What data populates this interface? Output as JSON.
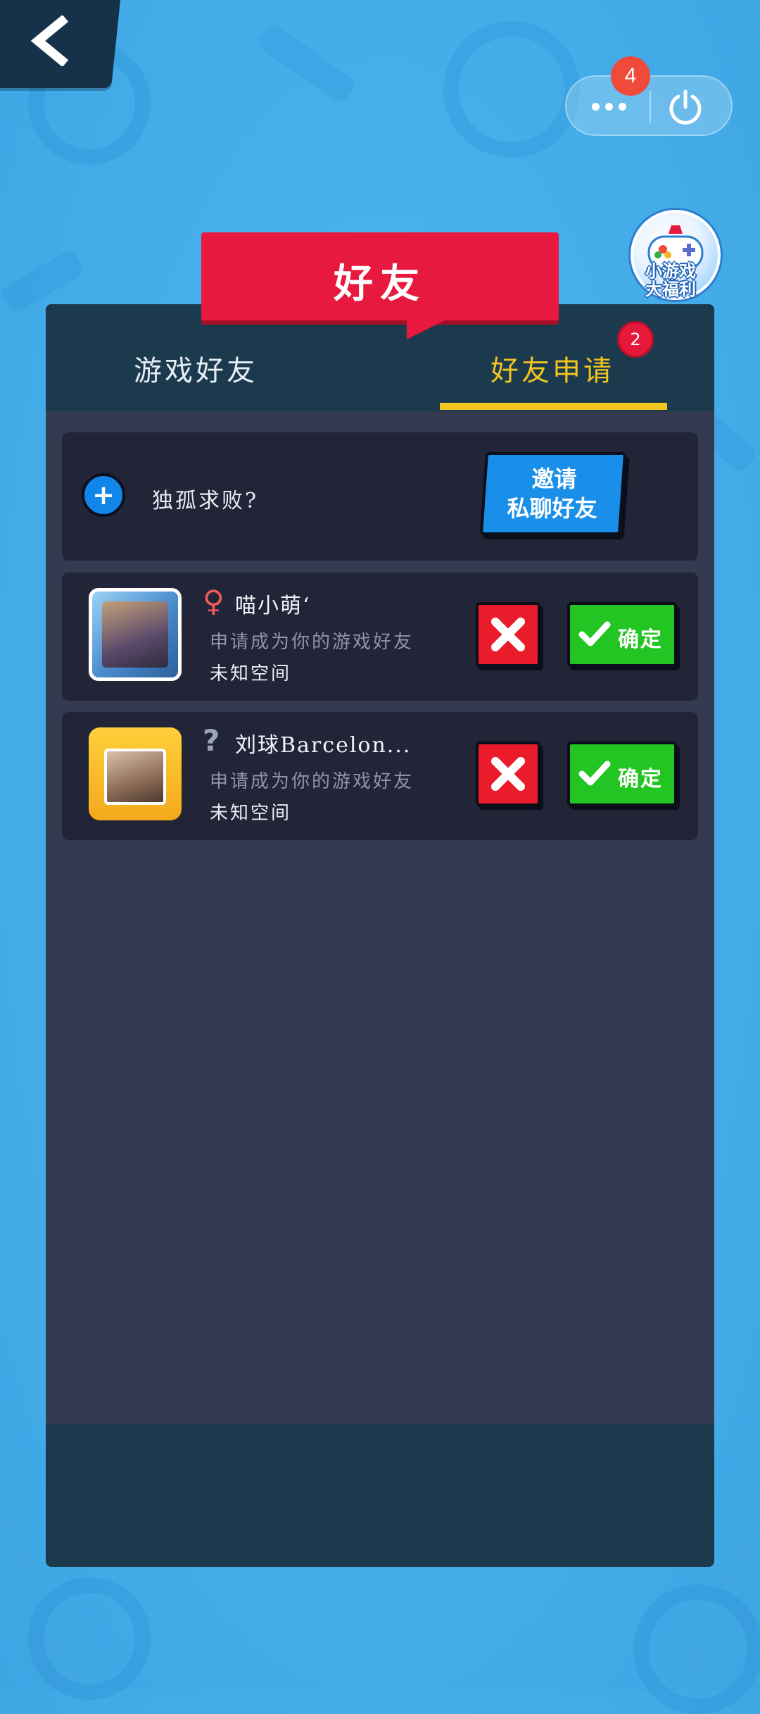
{
  "nav": {
    "back_icon": "chevron-left-icon"
  },
  "capsule": {
    "more_icon": "more-dots-icon",
    "power_icon": "power-icon",
    "badge_count": "4"
  },
  "promo": {
    "label_line1": "小游戏",
    "label_line2": "大福利",
    "icon": "gamepad-gift-icon"
  },
  "title": "好友",
  "tabs": [
    {
      "label": "游戏好友",
      "active": false
    },
    {
      "label": "好友申请",
      "active": true,
      "badge": "2"
    }
  ],
  "invite": {
    "icon": "plus-icon",
    "text": "独孤求败?",
    "button_line1": "邀请",
    "button_line2": "私聊好友"
  },
  "requests": [
    {
      "gender_icon": "♀",
      "name": "喵小萌‘",
      "message": "申请成为你的游戏好友",
      "location": "未知空间",
      "reject_icon": "close-x-icon",
      "accept_icon": "checkmark-icon",
      "accept_label": "确定"
    },
    {
      "gender_icon": "?",
      "name": "刘球Barcelon...",
      "message": "申请成为你的游戏好友",
      "location": "未知空间",
      "reject_icon": "close-x-icon",
      "accept_icon": "checkmark-icon",
      "accept_label": "确定"
    }
  ],
  "colors": {
    "background": "#45aeea",
    "ribbon": "#e8193e",
    "active_tab": "#f2c420",
    "reject": "#ea1c2c",
    "accept": "#23c522",
    "invite_button": "#1a8fea"
  }
}
